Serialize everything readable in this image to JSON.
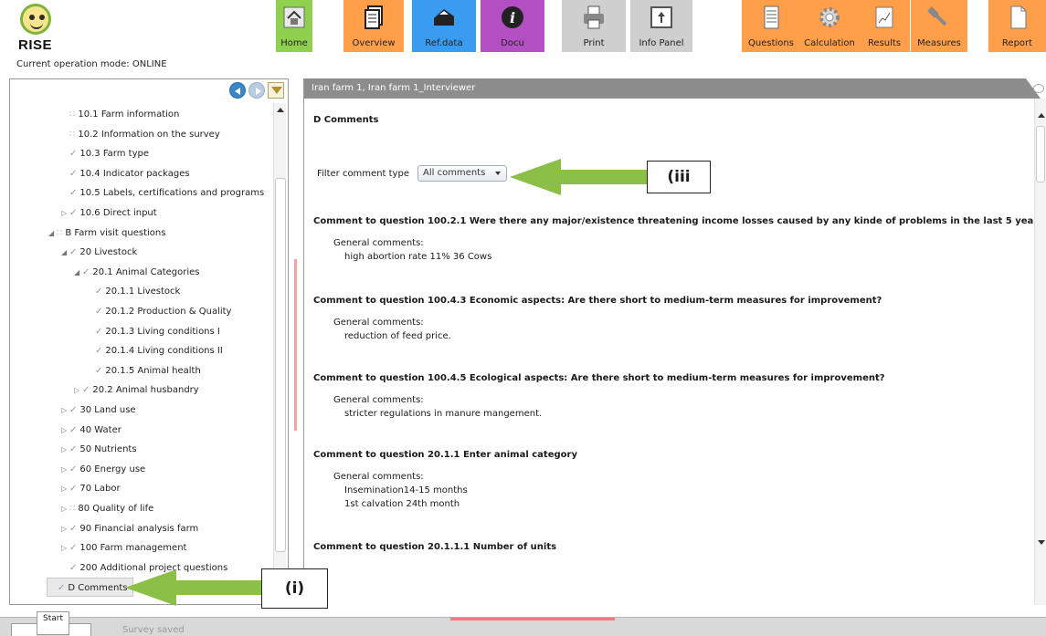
{
  "app": {
    "logo_text": "RISE",
    "mode_label": "Current operation mode: ONLINE"
  },
  "toolbar": [
    {
      "id": "home",
      "label": "Home",
      "color": "#8fd14f",
      "icon": "house-icon"
    },
    {
      "id": "overview",
      "label": "Overview",
      "color": "#ff9f4a",
      "icon": "documents-icon"
    },
    {
      "id": "refdata",
      "label": "Ref.data",
      "color": "#3a9cf0",
      "icon": "database-icon"
    },
    {
      "id": "docu",
      "label": "Docu",
      "color": "#b34fc3",
      "icon": "info-icon"
    },
    {
      "id": "print",
      "label": "Print",
      "color": "#cfcfcf",
      "icon": "printer-icon"
    },
    {
      "id": "infopanel",
      "label": "Info Panel",
      "color": "#cfcfcf",
      "icon": "info-panel-icon"
    },
    {
      "id": "questions",
      "label": "Questions",
      "color": "#ff9f4a",
      "icon": "questionnaire-icon"
    },
    {
      "id": "calculation",
      "label": "Calculation",
      "color": "#ff9f4a",
      "icon": "gear-icon"
    },
    {
      "id": "results",
      "label": "Results",
      "color": "#ff9f4a",
      "icon": "chart-icon"
    },
    {
      "id": "measures",
      "label": "Measures",
      "color": "#ff9f4a",
      "icon": "wrench-icon"
    },
    {
      "id": "report",
      "label": "Report",
      "color": "#ff9f4a",
      "icon": "report-icon"
    }
  ],
  "tree": {
    "items": [
      {
        "label": "10.1 Farm information",
        "mark": "box"
      },
      {
        "label": "10.2 Information on the survey",
        "mark": "box"
      },
      {
        "label": "10.3 Farm type",
        "mark": "check"
      },
      {
        "label": "10.4 Indicator packages",
        "mark": "check"
      },
      {
        "label": "10.5 Labels, certifications and programs",
        "mark": "check"
      },
      {
        "label": "10.6 Direct input",
        "mark": "check",
        "arrow": "collapsed"
      },
      {
        "label": "B Farm visit questions",
        "mark": "box",
        "arrow": "expanded"
      },
      {
        "label": "20 Livestock",
        "mark": "check",
        "arrow": "expanded"
      },
      {
        "label": "20.1 Animal Categories",
        "mark": "check",
        "arrow": "expanded"
      },
      {
        "label": "20.1.1 Livestock",
        "mark": "check"
      },
      {
        "label": "20.1.2 Production & Quality",
        "mark": "check"
      },
      {
        "label": "20.1.3 Living conditions I",
        "mark": "check"
      },
      {
        "label": "20.1.4 Living conditions II",
        "mark": "check"
      },
      {
        "label": "20.1.5 Animal health",
        "mark": "check"
      },
      {
        "label": "20.2 Animal husbandry",
        "mark": "check",
        "arrow": "collapsed"
      },
      {
        "label": "30 Land use",
        "mark": "check",
        "arrow": "collapsed"
      },
      {
        "label": "40 Water",
        "mark": "check",
        "arrow": "collapsed"
      },
      {
        "label": "50 Nutrients",
        "mark": "check",
        "arrow": "collapsed"
      },
      {
        "label": "60 Energy use",
        "mark": "check",
        "arrow": "collapsed"
      },
      {
        "label": "70 Labor",
        "mark": "check",
        "arrow": "collapsed"
      },
      {
        "label": "80 Quality of life",
        "mark": "box",
        "arrow": "collapsed"
      },
      {
        "label": "90 Financial analysis farm",
        "mark": "check",
        "arrow": "collapsed"
      },
      {
        "label": "100 Farm management",
        "mark": "check",
        "arrow": "collapsed"
      },
      {
        "label": "200 Additional project questions",
        "mark": "check"
      },
      {
        "label": "D Comments",
        "mark": "check",
        "selected": true
      }
    ]
  },
  "content": {
    "titlebar": "Iran farm 1, Iran farm 1_Interviewer",
    "section_title": "D Comments",
    "filter_label": "Filter comment type",
    "filter_value": "All comments",
    "comments": [
      {
        "question": "Comment to question 100.2.1 Were there any major/existence threatening income losses caused by any kinde of problems in the last 5 yea",
        "heading": "General comments:",
        "lines": [
          "high abortion rate 11% 36 Cows"
        ]
      },
      {
        "question": "Comment to question 100.4.3 Economic aspects: Are there short to medium-term measures for improvement?",
        "heading": "General comments:",
        "lines": [
          "reduction of feed price."
        ]
      },
      {
        "question": "Comment to question 100.4.5 Ecological aspects: Are there short to medium-term measures for improvement?",
        "heading": "General comments:",
        "lines": [
          "stricter regulations in manure mangement."
        ]
      },
      {
        "question": "Comment to question 20.1.1 Enter animal category",
        "heading": "General comments:",
        "lines": [
          "Insemination14-15 months",
          "1st calvation 24th month"
        ]
      },
      {
        "question": "Comment to question 20.1.1.1 Number of units",
        "heading": "",
        "lines": []
      }
    ]
  },
  "annotations": {
    "label_iii": "(iii",
    "label_i": "(i)",
    "arrow_color": "#8bbf48"
  },
  "statusbar": {
    "start_tab": "Start",
    "status_text": "Survey saved"
  }
}
